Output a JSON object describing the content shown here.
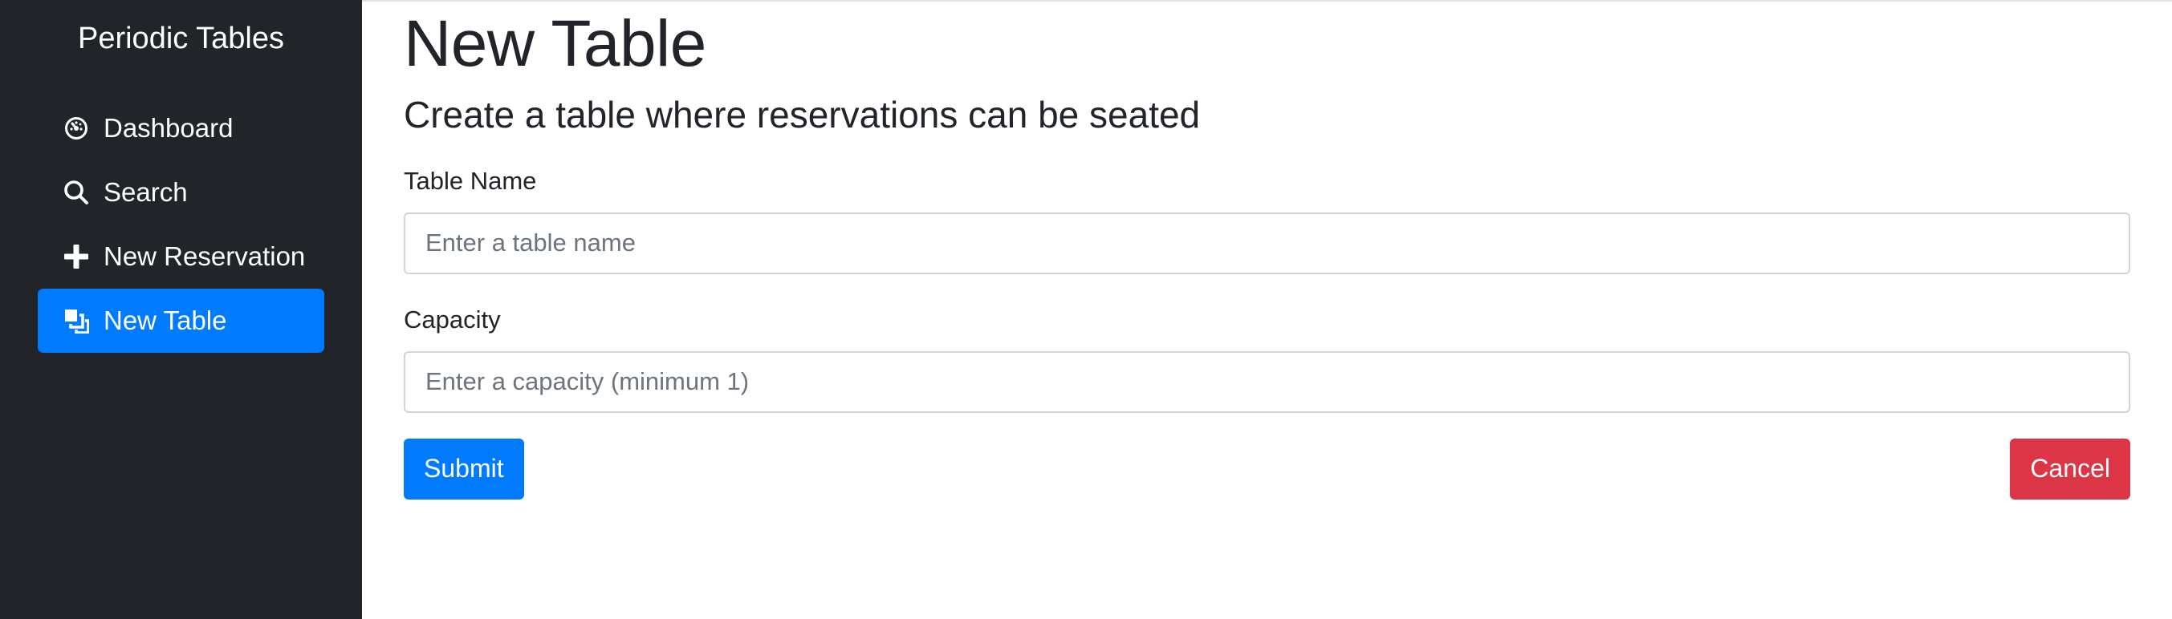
{
  "sidebar": {
    "brand": "Periodic Tables",
    "items": [
      {
        "label": "Dashboard",
        "icon": "dashboard-icon",
        "active": false
      },
      {
        "label": "Search",
        "icon": "search-icon",
        "active": false
      },
      {
        "label": "New Reservation",
        "icon": "plus-icon",
        "active": false
      },
      {
        "label": "New Table",
        "icon": "layers-icon",
        "active": true
      }
    ]
  },
  "main": {
    "title": "New Table",
    "subtitle": "Create a table where reservations can be seated",
    "fields": {
      "table_name": {
        "label": "Table Name",
        "value": "",
        "placeholder": "Enter a table name"
      },
      "capacity": {
        "label": "Capacity",
        "value": "",
        "placeholder": "Enter a capacity (minimum 1)"
      }
    },
    "buttons": {
      "submit": "Submit",
      "cancel": "Cancel"
    }
  },
  "colors": {
    "sidebar_bg": "#212529",
    "primary": "#007bff",
    "danger": "#dc3545",
    "text": "#212529"
  }
}
